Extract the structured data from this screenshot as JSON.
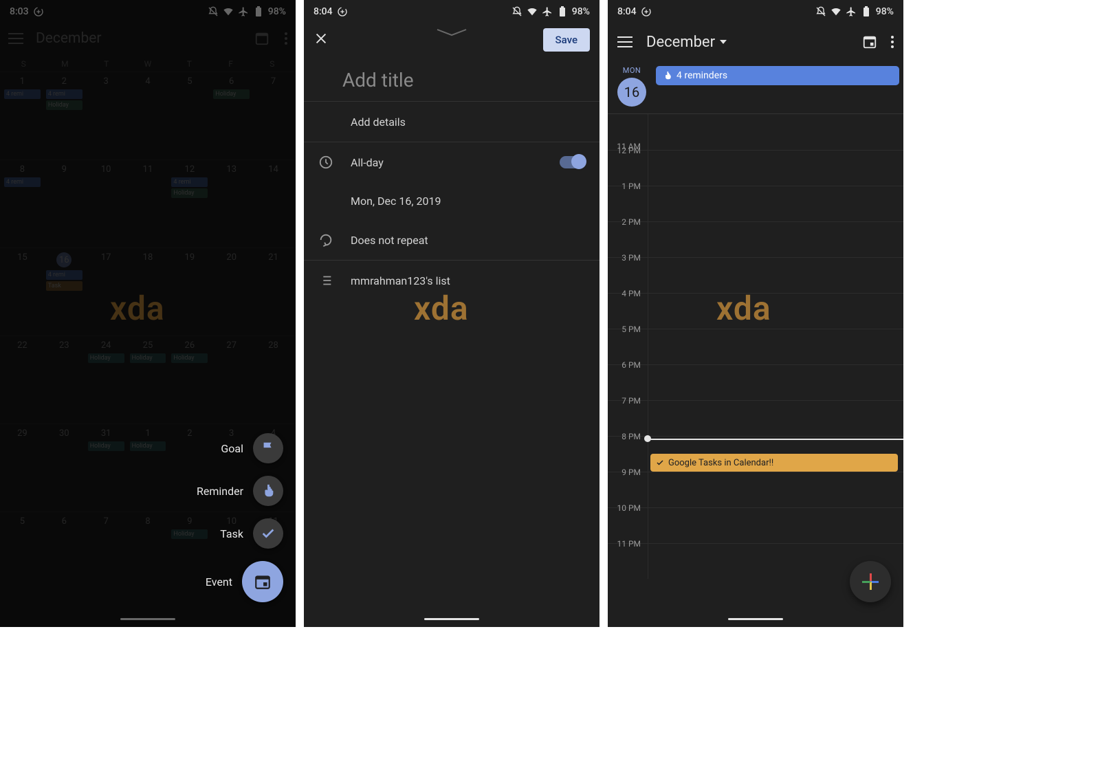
{
  "status": {
    "time1": "8:03",
    "time2": "8:04",
    "time3": "8:04",
    "battery": "98%"
  },
  "screen1": {
    "month": "December",
    "dow": [
      "S",
      "M",
      "T",
      "W",
      "T",
      "F",
      "S"
    ],
    "speed_dial": {
      "goal": "Goal",
      "reminder": "Reminder",
      "task": "Task",
      "event": "Event"
    }
  },
  "screen2": {
    "save": "Save",
    "title_placeholder": "Add title",
    "details": "Add details",
    "all_day": "All-day",
    "date": "Mon, Dec 16, 2019",
    "repeat": "Does not repeat",
    "list": "mmrahman123's list"
  },
  "screen3": {
    "month": "December",
    "dow": "MON",
    "dnum": "16",
    "reminders": "4 reminders",
    "hours": [
      "11 AM",
      "12 PM",
      "1 PM",
      "2 PM",
      "3 PM",
      "4 PM",
      "5 PM",
      "6 PM",
      "7 PM",
      "8 PM",
      "9 PM",
      "10 PM",
      "11 PM"
    ],
    "task_event": "Google Tasks in Calendar!!"
  },
  "watermark": "xda"
}
